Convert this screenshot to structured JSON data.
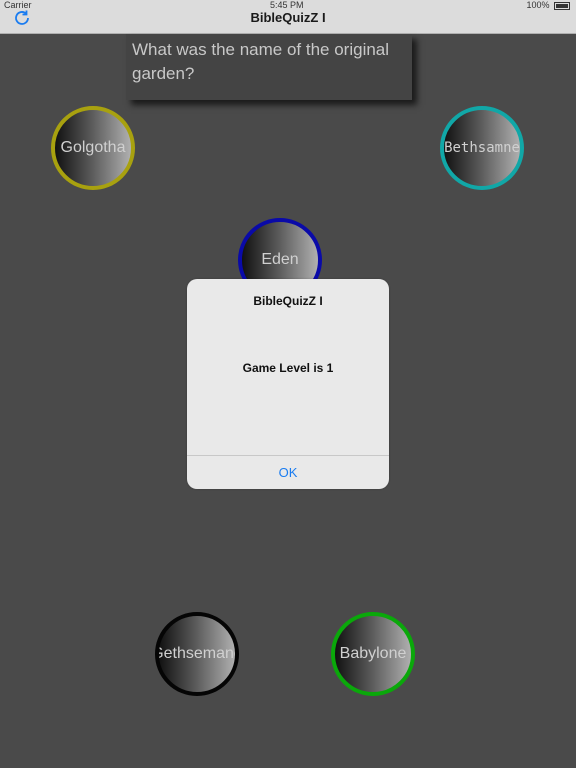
{
  "status_bar": {
    "carrier": "Carrier",
    "time": "5:45 PM",
    "battery": "100%"
  },
  "nav": {
    "title": "BibleQuizZ I",
    "refresh_icon": "refresh-icon"
  },
  "question": {
    "text": "What was the name of the original garden?"
  },
  "answers": [
    {
      "label": "Golgotha",
      "color": "#a8a10f"
    },
    {
      "label": "Bethsamne",
      "color": "#11a7a7"
    },
    {
      "label": "Eden",
      "color": "#0a0aa8"
    },
    {
      "label": "Gethsemane",
      "color": "#050505"
    },
    {
      "label": "Babylone",
      "color": "#0aa80a"
    }
  ],
  "alert": {
    "title": "BibleQuizZ I",
    "message": "Game Level is 1",
    "ok_label": "OK"
  },
  "colors": {
    "background": "#4a4a4a",
    "accent": "#1a7cf0"
  }
}
